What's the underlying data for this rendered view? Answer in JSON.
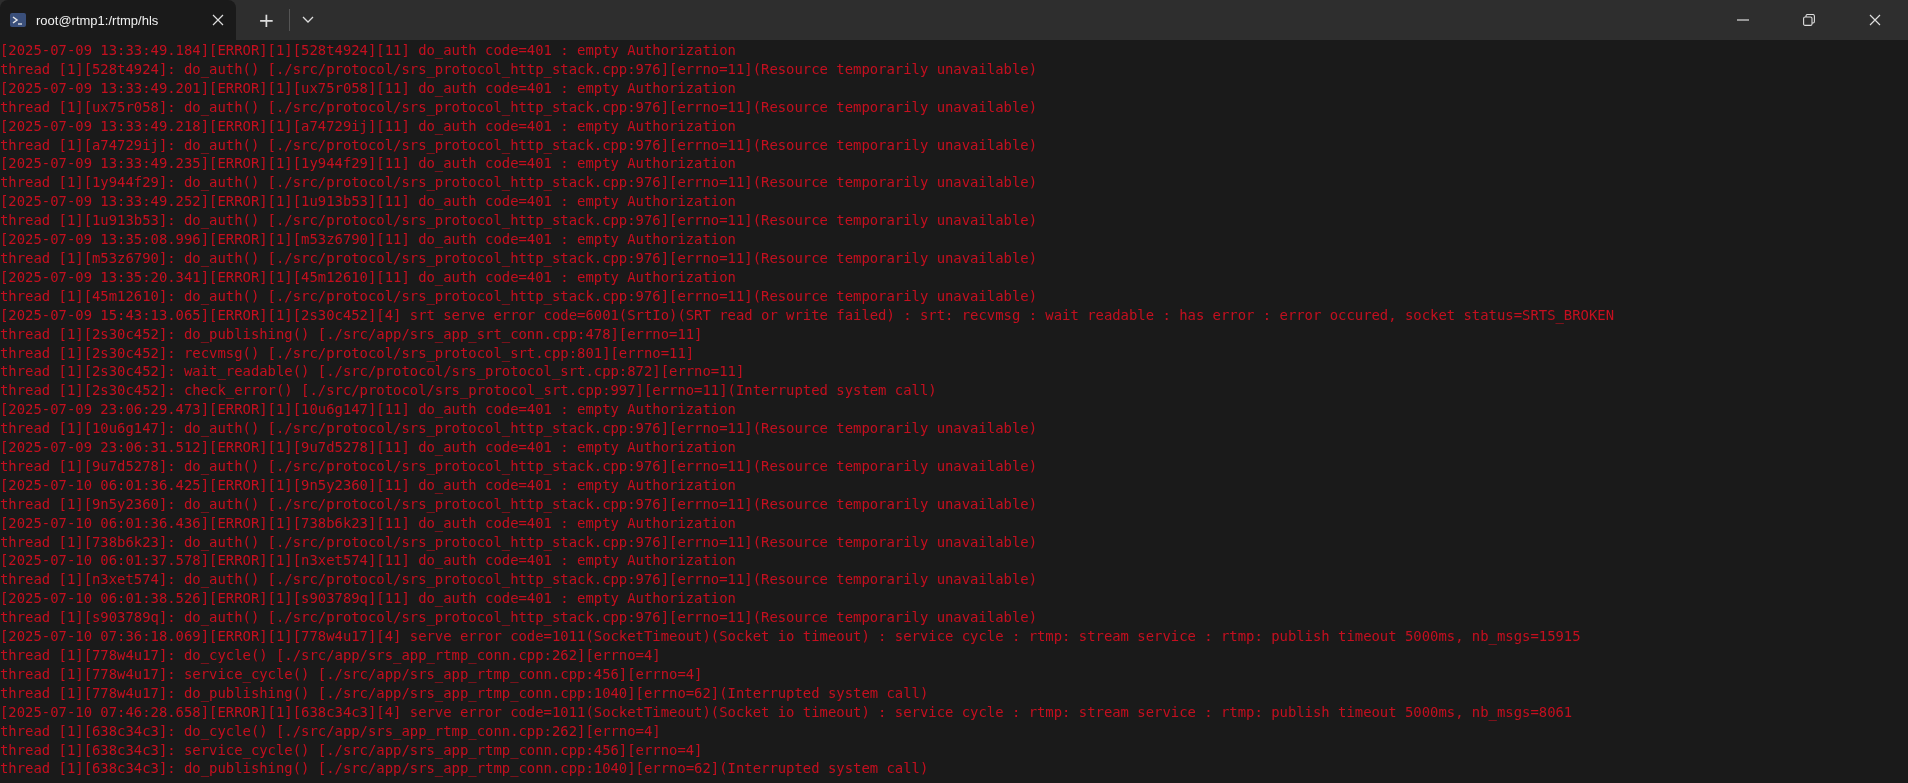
{
  "tabs": [
    {
      "title": "root@rtmp1:/rtmp/hls",
      "selected": true
    }
  ],
  "new_tab_button": "+",
  "lines": [
    "[2025-07-09 13:33:49.184][ERROR][1][528t4924][11] do_auth code=401 : empty Authorization",
    "thread [1][528t4924]: do_auth() [./src/protocol/srs_protocol_http_stack.cpp:976][errno=11](Resource temporarily unavailable)",
    "[2025-07-09 13:33:49.201][ERROR][1][ux75r058][11] do_auth code=401 : empty Authorization",
    "thread [1][ux75r058]: do_auth() [./src/protocol/srs_protocol_http_stack.cpp:976][errno=11](Resource temporarily unavailable)",
    "[2025-07-09 13:33:49.218][ERROR][1][a74729ij][11] do_auth code=401 : empty Authorization",
    "thread [1][a74729ij]: do_auth() [./src/protocol/srs_protocol_http_stack.cpp:976][errno=11](Resource temporarily unavailable)",
    "[2025-07-09 13:33:49.235][ERROR][1][1y944f29][11] do_auth code=401 : empty Authorization",
    "thread [1][1y944f29]: do_auth() [./src/protocol/srs_protocol_http_stack.cpp:976][errno=11](Resource temporarily unavailable)",
    "[2025-07-09 13:33:49.252][ERROR][1][1u913b53][11] do_auth code=401 : empty Authorization",
    "thread [1][1u913b53]: do_auth() [./src/protocol/srs_protocol_http_stack.cpp:976][errno=11](Resource temporarily unavailable)",
    "[2025-07-09 13:35:08.996][ERROR][1][m53z6790][11] do_auth code=401 : empty Authorization",
    "thread [1][m53z6790]: do_auth() [./src/protocol/srs_protocol_http_stack.cpp:976][errno=11](Resource temporarily unavailable)",
    "[2025-07-09 13:35:20.341][ERROR][1][45m12610][11] do_auth code=401 : empty Authorization",
    "thread [1][45m12610]: do_auth() [./src/protocol/srs_protocol_http_stack.cpp:976][errno=11](Resource temporarily unavailable)",
    "[2025-07-09 15:43:13.065][ERROR][1][2s30c452][4] srt serve error code=6001(SrtIo)(SRT read or write failed) : srt: recvmsg : wait readable : has error : error occured, socket status=SRTS_BROKEN",
    "thread [1][2s30c452]: do_publishing() [./src/app/srs_app_srt_conn.cpp:478][errno=11]",
    "thread [1][2s30c452]: recvmsg() [./src/protocol/srs_protocol_srt.cpp:801][errno=11]",
    "thread [1][2s30c452]: wait_readable() [./src/protocol/srs_protocol_srt.cpp:872][errno=11]",
    "thread [1][2s30c452]: check_error() [./src/protocol/srs_protocol_srt.cpp:997][errno=11](Interrupted system call)",
    "[2025-07-09 23:06:29.473][ERROR][1][10u6g147][11] do_auth code=401 : empty Authorization",
    "thread [1][10u6g147]: do_auth() [./src/protocol/srs_protocol_http_stack.cpp:976][errno=11](Resource temporarily unavailable)",
    "[2025-07-09 23:06:31.512][ERROR][1][9u7d5278][11] do_auth code=401 : empty Authorization",
    "thread [1][9u7d5278]: do_auth() [./src/protocol/srs_protocol_http_stack.cpp:976][errno=11](Resource temporarily unavailable)",
    "[2025-07-10 06:01:36.425][ERROR][1][9n5y2360][11] do_auth code=401 : empty Authorization",
    "thread [1][9n5y2360]: do_auth() [./src/protocol/srs_protocol_http_stack.cpp:976][errno=11](Resource temporarily unavailable)",
    "[2025-07-10 06:01:36.436][ERROR][1][738b6k23][11] do_auth code=401 : empty Authorization",
    "thread [1][738b6k23]: do_auth() [./src/protocol/srs_protocol_http_stack.cpp:976][errno=11](Resource temporarily unavailable)",
    "[2025-07-10 06:01:37.578][ERROR][1][n3xet574][11] do_auth code=401 : empty Authorization",
    "thread [1][n3xet574]: do_auth() [./src/protocol/srs_protocol_http_stack.cpp:976][errno=11](Resource temporarily unavailable)",
    "[2025-07-10 06:01:38.526][ERROR][1][s903789q][11] do_auth code=401 : empty Authorization",
    "thread [1][s903789q]: do_auth() [./src/protocol/srs_protocol_http_stack.cpp:976][errno=11](Resource temporarily unavailable)",
    "[2025-07-10 07:36:18.069][ERROR][1][778w4u17][4] serve error code=1011(SocketTimeout)(Socket io timeout) : service cycle : rtmp: stream service : rtmp: publish timeout 5000ms, nb_msgs=15915",
    "thread [1][778w4u17]: do_cycle() [./src/app/srs_app_rtmp_conn.cpp:262][errno=4]",
    "thread [1][778w4u17]: service_cycle() [./src/app/srs_app_rtmp_conn.cpp:456][errno=4]",
    "thread [1][778w4u17]: do_publishing() [./src/app/srs_app_rtmp_conn.cpp:1040][errno=62](Interrupted system call)",
    "[2025-07-10 07:46:28.658][ERROR][1][638c34c3][4] serve error code=1011(SocketTimeout)(Socket io timeout) : service cycle : rtmp: stream service : rtmp: publish timeout 5000ms, nb_msgs=8061",
    "thread [1][638c34c3]: do_cycle() [./src/app/srs_app_rtmp_conn.cpp:262][errno=4]",
    "thread [1][638c34c3]: service_cycle() [./src/app/srs_app_rtmp_conn.cpp:456][errno=4]",
    "thread [1][638c34c3]: do_publishing() [./src/app/srs_app_rtmp_conn.cpp:1040][errno=62](Interrupted system call)"
  ]
}
